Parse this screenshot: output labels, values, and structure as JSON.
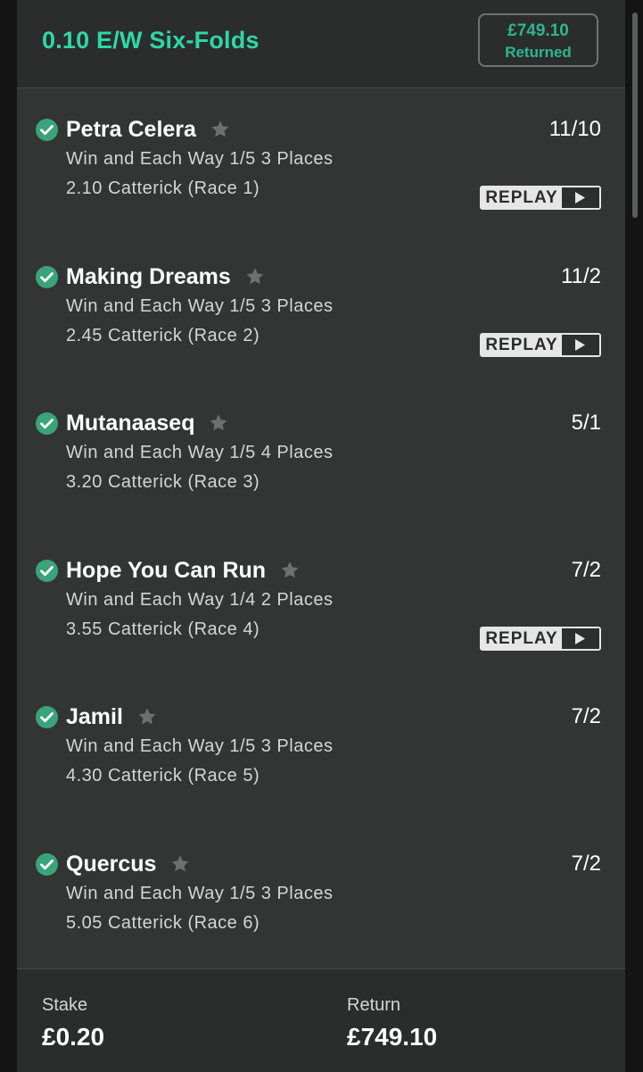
{
  "header": {
    "title": "0.10 E/W Six-Folds",
    "returned_amount": "£749.10",
    "returned_label": "Returned"
  },
  "selections": [
    {
      "name": "Petra Celera",
      "odds": "11/10",
      "market": "Win and Each Way 1/5 3 Places",
      "race": "2.10 Catterick (Race 1)",
      "replay": true
    },
    {
      "name": "Making Dreams",
      "odds": "11/2",
      "market": "Win and Each Way 1/5 3 Places",
      "race": "2.45 Catterick (Race 2)",
      "replay": true
    },
    {
      "name": "Mutanaaseq",
      "odds": "5/1",
      "market": "Win and Each Way 1/5 4 Places",
      "race": "3.20 Catterick (Race 3)",
      "replay": false
    },
    {
      "name": "Hope You Can Run",
      "odds": "7/2",
      "market": "Win and Each Way 1/4 2 Places",
      "race": "3.55 Catterick (Race 4)",
      "replay": true
    },
    {
      "name": "Jamil",
      "odds": "7/2",
      "market": "Win and Each Way 1/5 3 Places",
      "race": "4.30 Catterick (Race 5)",
      "replay": false
    },
    {
      "name": "Quercus",
      "odds": "7/2",
      "market": "Win and Each Way 1/5 3 Places",
      "race": "5.05 Catterick (Race 6)",
      "replay": false
    }
  ],
  "replay_label": "REPLAY",
  "footer": {
    "stake_label": "Stake",
    "stake_value": "£0.20",
    "return_label": "Return",
    "return_value": "£749.10"
  },
  "colors": {
    "accent": "#2fd6a6",
    "check": "#3aa37a",
    "card": "#323534"
  },
  "icons": {
    "check": "check-circle-icon",
    "favourite": "star-icon",
    "play": "play-icon"
  }
}
